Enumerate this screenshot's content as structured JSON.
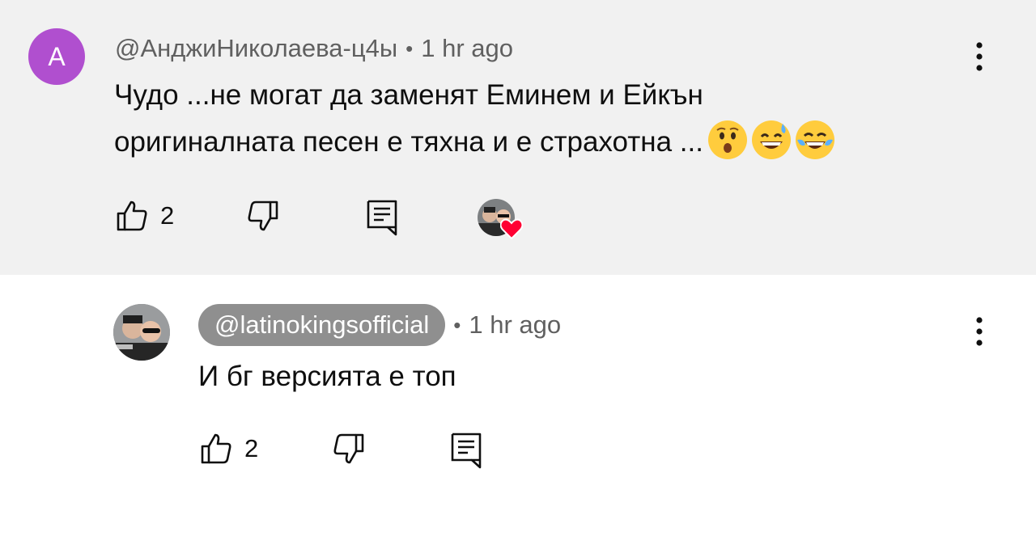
{
  "comment": {
    "avatar_letter": "A",
    "author": "@АнджиНиколаева-ц4ы",
    "separator": "•",
    "time": "1 hr ago",
    "text_line1": "Чудо ...не могат да заменят Еминем и Ейкън",
    "text_line2": "оригиналната песен е тяхна и е страхотна ...",
    "emojis": [
      "astonished-face",
      "grinning-sweat-face",
      "tears-of-joy-face"
    ],
    "likes": "2",
    "creator_hearted": true
  },
  "reply": {
    "author": "@latinokingsofficial",
    "separator": "•",
    "time": "1 hr ago",
    "text": "И бг версията е топ",
    "likes": "2"
  },
  "colors": {
    "top_background": "#f1f1f1",
    "avatar_letter_bg": "#b04fcf",
    "author_pill_bg": "#8f8f8f",
    "heart": "#ff0033",
    "meta_text": "#606060"
  }
}
